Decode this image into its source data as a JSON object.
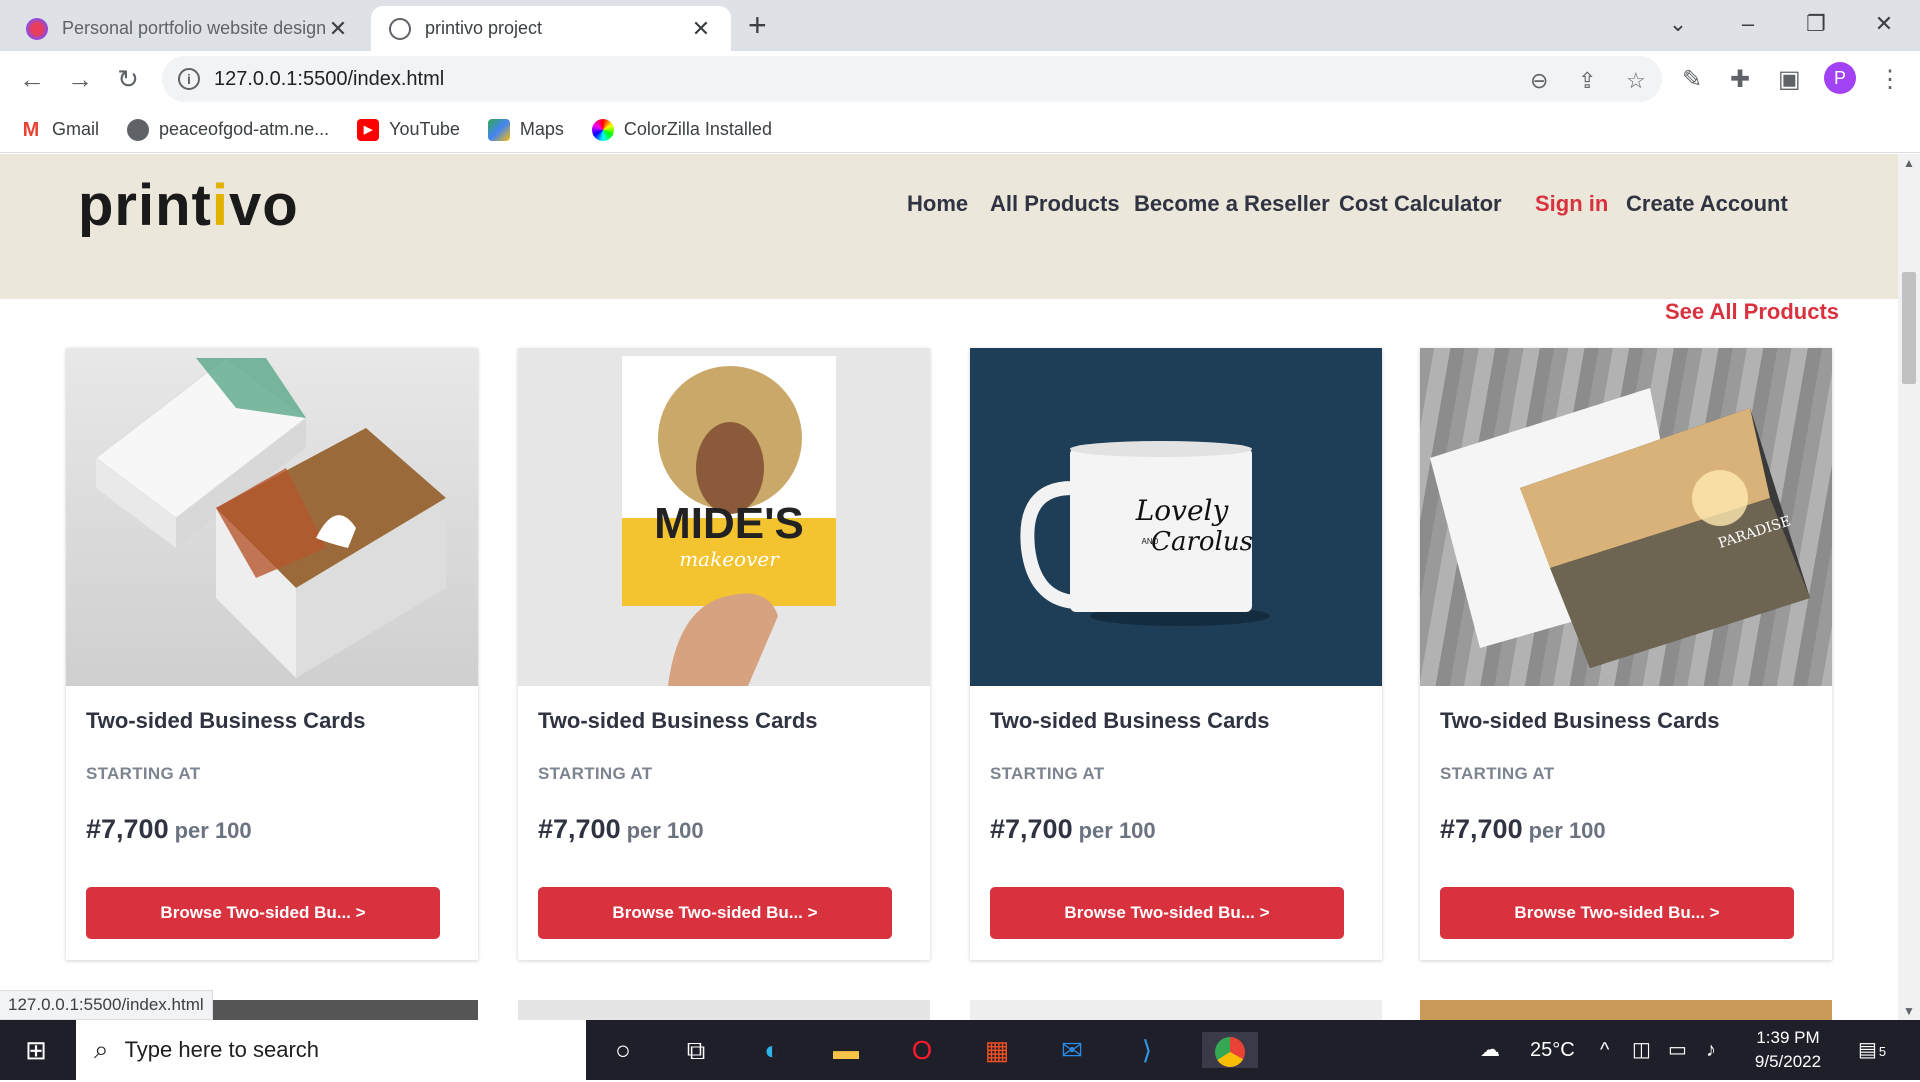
{
  "browser": {
    "tabs": [
      {
        "title": "Personal portfolio website design",
        "active": false
      },
      {
        "title": "printivo project",
        "active": true
      }
    ],
    "url": "127.0.0.1:5500/index.html",
    "profile_initial": "P",
    "bookmarks": [
      {
        "label": "Gmail",
        "icon": "gmail-icon"
      },
      {
        "label": "peaceofgod-atm.ne...",
        "icon": "globe-icon"
      },
      {
        "label": "YouTube",
        "icon": "youtube-icon"
      },
      {
        "label": "Maps",
        "icon": "maps-icon"
      },
      {
        "label": "ColorZilla Installed",
        "icon": "colorzilla-icon"
      }
    ],
    "status_url": "127.0.0.1:5500/index.html"
  },
  "site": {
    "logo": {
      "before": "print",
      "dot_letter": "i",
      "after": "vo"
    },
    "nav": [
      "Home",
      "All Products",
      "Become a Reseller",
      "Cost Calculator",
      "Sign in",
      "Create Account"
    ],
    "see_all": "See All Products",
    "products": [
      {
        "name": "Two-sided Business Cards",
        "starting": "STARTING AT",
        "price": "#7,700",
        "per": "per 100",
        "button": "Browse Two-sided Bu...  >"
      },
      {
        "name": "Two-sided Business Cards",
        "starting": "STARTING AT",
        "price": "#7,700",
        "per": "per 100",
        "button": "Browse Two-sided Bu...  >",
        "img_text": {
          "title": "MIDE'S",
          "sub": "makeover"
        }
      },
      {
        "name": "Two-sided Business Cards",
        "starting": "STARTING AT",
        "price": "#7,700",
        "per": "per 100",
        "button": "Browse Two-sided Bu...  >",
        "img_text": {
          "line1": "Lovely",
          "and": "AND",
          "line2": "Carolus"
        }
      },
      {
        "name": "Two-sided Business Cards",
        "starting": "STARTING AT",
        "price": "#7,700",
        "per": "per 100",
        "button": "Browse Two-sided Bu...  >",
        "img_text": {
          "brand": "PARADISE"
        }
      }
    ]
  },
  "taskbar": {
    "search_placeholder": "Type here to search",
    "temperature": "25°C",
    "time": "1:39 PM",
    "date": "9/5/2022",
    "notifications": "5"
  },
  "colors": {
    "accent": "#d9323f",
    "header_bg": "#ebe7db",
    "text_dark": "#2f3342"
  }
}
